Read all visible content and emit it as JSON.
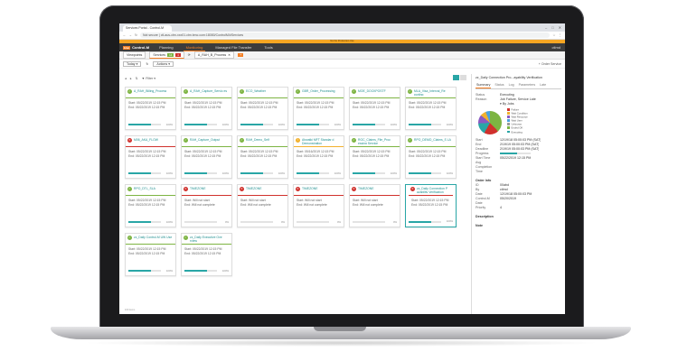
{
  "browser": {
    "tab_title": "Services Portal - Control-M",
    "not_secure": "Not secure",
    "url": "ctl-aus-ctm-xxx01.ctm.bmc.com:18080/ControlM/#Services",
    "notice": "Not for Production Use"
  },
  "app": {
    "brand": "bmc",
    "product": "Control-M",
    "nav": [
      "Planning",
      "Monitoring",
      "Managed File Transfer",
      "Tools"
    ],
    "user": "ctlmd"
  },
  "views": {
    "viewpoints": "Viewpoints",
    "services": "Services",
    "count_ok": "14",
    "count_fail": "4",
    "open_tab": "A_RAH_B_Process"
  },
  "toolbar": {
    "today": "Today",
    "actions": "Actions",
    "order_service": "Order Service",
    "filter": "Filter"
  },
  "cards": [
    {
      "name": "A_RAH_Billing_Process",
      "status": "ok",
      "l1": "Start: 05/22/2019 12:15 PM",
      "l2": "End: 05/22/2019 12:15 PM",
      "progress": 0.7,
      "pct": "100%"
    },
    {
      "name": "A_RAH_Capture_Servic es",
      "status": "ok",
      "l1": "Start: 05/22/2019 12:15 PM",
      "l2": "End: 05/22/2019 12:15 PM",
      "progress": 0.7,
      "pct": "100%"
    },
    {
      "name": "ECO_Weather",
      "status": "ok",
      "l1": "Start: 05/22/2019 12:15 PM",
      "l2": "End: 05/22/2019 12:15 PM",
      "progress": 0.7,
      "pct": "100%"
    },
    {
      "name": "GBR_Order_Processing",
      "status": "ok",
      "l1": "Start: 05/22/2019 12:15 PM",
      "l2": "End: 05/22/2019 12:15 PM",
      "progress": 0.7,
      "pct": "100%"
    },
    {
      "name": "MOE_DOCKPOSTF",
      "status": "ok",
      "l1": "Start: 05/22/2019 12:15 PM",
      "l2": "End: 05/22/2019 12:15 PM",
      "progress": 0.7,
      "pct": "100%"
    },
    {
      "name": "MLA_Visa_Interval_Re porting",
      "status": "ok",
      "l1": "Start: 05/22/2019 12:15 PM",
      "l2": "End: 05/22/2019 12:15 PM",
      "progress": 0.7,
      "pct": "100%"
    },
    {
      "name": "M06_AKA_FLOW",
      "status": "fail",
      "l1": "Start: 05/22/2019 12:15 PM",
      "l2": "End: 05/22/2019 12:15 PM",
      "progress": 0.7,
      "pct": "100%"
    },
    {
      "name": "RAH_Capture_Output",
      "status": "ok",
      "l1": "Start: 05/22/2019 12:15 PM",
      "l2": "End: 05/22/2019 12:15 PM",
      "progress": 0.7,
      "pct": "100%"
    },
    {
      "name": "RAH_Demo_Self",
      "status": "ok",
      "l1": "Start: 05/22/2019 12:15 PM",
      "l2": "End: 05/22/2019 12:15 PM",
      "progress": 0.7,
      "pct": "100%"
    },
    {
      "name": "Ahwatki MFT Standar d Demonstration",
      "status": "wait",
      "l1": "Start: 05/16/2019 12:15 PM",
      "l2": "End: 05/22/2019 12:15 PM",
      "progress": 0.7,
      "pct": "100%"
    },
    {
      "name": "ROC_Claims_File_Proc essing Service",
      "status": "ok",
      "l1": "Start: 05/22/2019 12:15 PM",
      "l2": "End: 05/22/2019 12:15 PM",
      "progress": 0.7,
      "pct": "100%"
    },
    {
      "name": "RPO_DEMO_Claims_S LA",
      "status": "ok",
      "l1": "Start: 05/22/2019 12:15 PM",
      "l2": "End: 05/22/2019 12:15 PM",
      "progress": 0.7,
      "pct": "100%"
    },
    {
      "name": "RPO_DTL_SLA",
      "status": "ok",
      "l1": "Start: 05/22/2019 12:15 PM",
      "l2": "End: 05/22/2019 12:15 PM",
      "progress": 0.7,
      "pct": "100%"
    },
    {
      "name": "TIMEZONE",
      "status": "fail",
      "l1": "Start: Will not start",
      "l2": "End: Will not complete",
      "progress": 0.0,
      "pct": "0%"
    },
    {
      "name": "TIMEZONE",
      "status": "fail",
      "l1": "Start: Will not start",
      "l2": "End: Will not complete",
      "progress": 0.0,
      "pct": "0%"
    },
    {
      "name": "TIMEZONE",
      "status": "fail",
      "l1": "Start: Will not start",
      "l2": "End: Will not complete",
      "progress": 0.0,
      "pct": "0%"
    },
    {
      "name": "TIMEZONE",
      "status": "fail",
      "l1": "Start: Will not start",
      "l2": "End: Will not complete",
      "progress": 0.0,
      "pct": "0%"
    },
    {
      "name": "zz_Daily Connection P ayability Verification",
      "status": "fail",
      "l1": "Start: 05/22/2019 12:15 PM",
      "l2": "End: 05/22/2019 12:15 PM",
      "progress": 0.7,
      "pct": "100%",
      "selected": true
    },
    {
      "name": "zz_Daily Control-M UW Use",
      "status": "ok",
      "l1": "Start: 05/22/2019 12:15 PM",
      "l2": "End: 05/22/2019 12:15 PM",
      "progress": 0.7,
      "pct": "100%"
    },
    {
      "name": "zz_Daily Executive Ove rview",
      "status": "ok",
      "l1": "Start: 05/22/2019 12:15 PM",
      "l2": "End: 05/22/2019 12:15 PM",
      "progress": 0.7,
      "pct": "100%"
    }
  ],
  "footer_note": "100 items",
  "detail": {
    "title": "zz_Daily Connection Pro...ayability Verification",
    "tabs": [
      "Summary",
      "Status",
      "Log",
      "Parameters",
      "Late"
    ],
    "status_label": "Status",
    "status_value": "Executing",
    "reason_label": "Reason",
    "reason_value": "Job Failure, Service Late",
    "jobs_label": "By Jobs",
    "legend": [
      {
        "name": "Failure",
        "color": "#d0312d"
      },
      {
        "name": "Wait Condition",
        "color": "#f2b12e"
      },
      {
        "name": "Wait Resource",
        "color": "#8a5ac2"
      },
      {
        "name": "Wait User",
        "color": "#4aa3df"
      },
      {
        "name": "Unknown",
        "color": "#999999"
      },
      {
        "name": "Ended OK",
        "color": "#7db442"
      },
      {
        "name": "Executing",
        "color": "#29a6a6"
      }
    ],
    "fields": [
      {
        "k": "Start",
        "v": "12/19/18 05:00:03 PM (SAT)"
      },
      {
        "k": "End",
        "v": "2/19/19 05:00:03 PM (SAT)"
      },
      {
        "k": "Deadline",
        "v": "2/19/19 05:00:03 PM (SAT)"
      },
      {
        "k": "Progress",
        "v": ""
      },
      {
        "k": "Start Time",
        "v": "05/22/2019 12:15 PM"
      },
      {
        "k": "Avg Completion Time",
        "v": ""
      }
    ],
    "progress": 0.55,
    "order_info": "Order Info",
    "order_fields": [
      {
        "k": "ID",
        "v": "00abd"
      },
      {
        "k": "By",
        "v": "ctlmd"
      },
      {
        "k": "Date",
        "v": "12/19/18 05:00:03 PM"
      },
      {
        "k": "Control-M Date",
        "v": "05/20/2019"
      }
    ],
    "priority_label": "Priority",
    "priority_value": "4",
    "description_label": "Description",
    "note_label": "Note"
  }
}
